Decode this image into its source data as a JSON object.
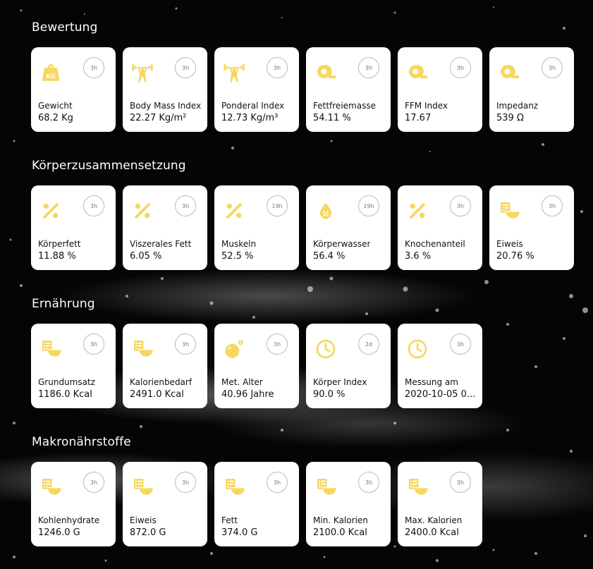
{
  "accent_color": "#f5d85d",
  "sections": [
    {
      "title": "Bewertung",
      "cards": [
        {
          "icon": "weight-kg-icon",
          "label": "Gewicht",
          "value": "68.2 Kg",
          "age": "3h"
        },
        {
          "icon": "weightlifter-icon",
          "label": "Body Mass Index",
          "value": "22.27 Kg/m²",
          "age": "3h"
        },
        {
          "icon": "weightlifter-icon",
          "label": "Ponderal Index",
          "value": "12.73 Kg/m³",
          "age": "3h"
        },
        {
          "icon": "tape-measure-icon",
          "label": "Fettfreiemasse",
          "value": "54.11 %",
          "age": "3h"
        },
        {
          "icon": "tape-measure-icon",
          "label": "FFM Index",
          "value": "17.67",
          "age": "3h"
        },
        {
          "icon": "tape-measure-icon",
          "label": "Impedanz",
          "value": "539 Ω",
          "age": "3h"
        }
      ]
    },
    {
      "title": "Körperzusammensetzung",
      "cards": [
        {
          "icon": "percent-icon",
          "label": "Körperfett",
          "value": "11.88 %",
          "age": "3h"
        },
        {
          "icon": "percent-icon",
          "label": "Viszerales Fett",
          "value": "6.05 %",
          "age": "3h"
        },
        {
          "icon": "percent-icon",
          "label": "Muskeln",
          "value": "52.5 %",
          "age": "19h"
        },
        {
          "icon": "water-percent-icon",
          "label": "Körperwasser",
          "value": "56.4 %",
          "age": "19h"
        },
        {
          "icon": "percent-icon",
          "label": "Knochenanteil",
          "value": "3.6 %",
          "age": "3h"
        },
        {
          "icon": "food-nutrition-icon",
          "label": "Eiweis",
          "value": "20.76 %",
          "age": "3h"
        }
      ]
    },
    {
      "title": "Ernährung",
      "cards": [
        {
          "icon": "food-nutrition-icon",
          "label": "Grundumsatz",
          "value": "1186.0 Kcal",
          "age": "3h"
        },
        {
          "icon": "food-nutrition-icon",
          "label": "Kalorienbedarf",
          "value": "2491.0 Kcal",
          "age": "3h"
        },
        {
          "icon": "bomb-icon",
          "label": "Met. Alter",
          "value": "40.96 Jahre",
          "age": "3h"
        },
        {
          "icon": "clock-icon",
          "label": "Körper Index",
          "value": "90.0 %",
          "age": "2d"
        },
        {
          "icon": "clock-icon",
          "label": "Messung am",
          "value": "2020-10-05 0...",
          "age": "3h"
        }
      ]
    },
    {
      "title": "Makronährstoffe",
      "cards": [
        {
          "icon": "food-nutrition-icon",
          "label": "Kohlenhydrate",
          "value": "1246.0 G",
          "age": "3h"
        },
        {
          "icon": "food-nutrition-icon",
          "label": "Eiweis",
          "value": "872.0 G",
          "age": "3h"
        },
        {
          "icon": "food-nutrition-icon",
          "label": "Fett",
          "value": "374.0 G",
          "age": "3h"
        },
        {
          "icon": "food-nutrition-icon",
          "label": "Min. Kalorien",
          "value": "2100.0 Kcal",
          "age": "3h"
        },
        {
          "icon": "food-nutrition-icon",
          "label": "Max. Kalorien",
          "value": "2400.0 Kcal",
          "age": "3h"
        }
      ]
    }
  ]
}
